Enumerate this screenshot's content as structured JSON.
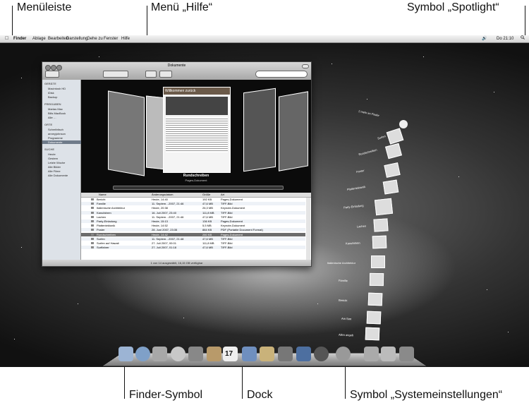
{
  "callouts": {
    "menubar": "Menüleiste",
    "help_menu": "Menü „Hilfe“",
    "spotlight": "Symbol „Spotlight“",
    "finder_icon": "Finder-Symbol",
    "dock": "Dock",
    "sysprefs": "Symbol „Systemeinstellungen“"
  },
  "menubar": {
    "items": [
      "Finder",
      "Ablage",
      "Bearbeiten",
      "Darstellung",
      "Gehe zu",
      "Fenster",
      "Hilfe"
    ],
    "clock": "Do 21:10"
  },
  "window": {
    "title": "Dokumente",
    "sidebar": {
      "devices_header": "GERÄTE",
      "devices": [
        "Macintosh HD",
        "iDisk",
        "Backup"
      ],
      "shared_header": "FREIGABEN",
      "shared": [
        "Martas Mac",
        "Bills MacBook",
        "Alle …"
      ],
      "places_header": "ORTE",
      "places": [
        "Schreibtisch",
        "anneyjohnson",
        "Programme",
        "Dokumente"
      ],
      "search_header": "SUCHE",
      "search": [
        "Heute",
        "Gestern",
        "Letzte Woche",
        "Alle Bilder",
        "Alle Filme",
        "Alle Dokumente"
      ]
    },
    "coverflow": {
      "doc_heading": "Willkommen zurück",
      "caption_title": "Rundschreiben",
      "caption_sub": "Pages-Dokument"
    },
    "columns": [
      "Name",
      "Änderungsdatum",
      "Größe",
      "Art"
    ],
    "rows": [
      [
        "Bericht",
        "Heute, 14:40",
        "192 KB",
        "Pages-Dokument"
      ],
      [
        "Familie",
        "11. Septem…2007, 21:46",
        "47,6 MB",
        "TIFF-Bild"
      ],
      [
        "Italienische Architektur",
        "Heute, 20:38",
        "26,3 MB",
        "Keynote-Dokument"
      ],
      [
        "Kanufahren",
        "16. Juli 2007, 23:40",
        "111,8 MB",
        "TIFF-Bild"
      ],
      [
        "Lachen",
        "11. Septem…2007, 21:46",
        "47,6 MB",
        "TIFF-Bild"
      ],
      [
        "Party-Einladung",
        "Heute, 15:13",
        "136 KB",
        "Pages-Dokument"
      ],
      [
        "Plattentektonik",
        "Heute, 14:52",
        "5,5 MB",
        "Keynote-Dokument"
      ],
      [
        "Poster",
        "28. Juni 2007, 23:35",
        "884 KB",
        "PDF (Portable Document Format)"
      ],
      [
        "Rundschreiben",
        "Heute, 14:42",
        "260 KB",
        "Pages-Dokument"
      ],
      [
        "Surfen",
        "11. Septem…2007, 21:48",
        "47,6 MB",
        "TIFF-Bild"
      ],
      [
        "Surfen auf Hawaii",
        "27. Juli 2007, 00:01",
        "111,8 MB",
        "TIFF-Bild"
      ],
      [
        "Surffahrer",
        "27. Juli 2007, 01:18",
        "47,6 MB",
        "TIFF-Bild"
      ]
    ],
    "status": "1 von 14 ausgewählt, 16,15 GB verfügbar"
  },
  "stack": {
    "open_in_finder": "2 mehr im Finder",
    "items": [
      "Surfen",
      "Rundschreiben",
      "Poster",
      "Plattentektonik",
      "Party-Einladung",
      "Lachen",
      "Kanufahren",
      "Italienische Architektur",
      "Familie",
      "Bericht",
      "Am See",
      "Allen angeb"
    ]
  },
  "dock": {
    "icons": [
      "finder-icon",
      "safari-icon",
      "mail-icon",
      "ichat-icon",
      "facetime-icon",
      "address-book-icon",
      "ical-icon",
      "itunes-icon",
      "iphoto-icon",
      "imovie-icon",
      "spaces-icon",
      "time-machine-icon",
      "system-preferences-icon",
      "stack-icon",
      "downloads-icon",
      "trash-icon"
    ],
    "ical_day": "17"
  }
}
